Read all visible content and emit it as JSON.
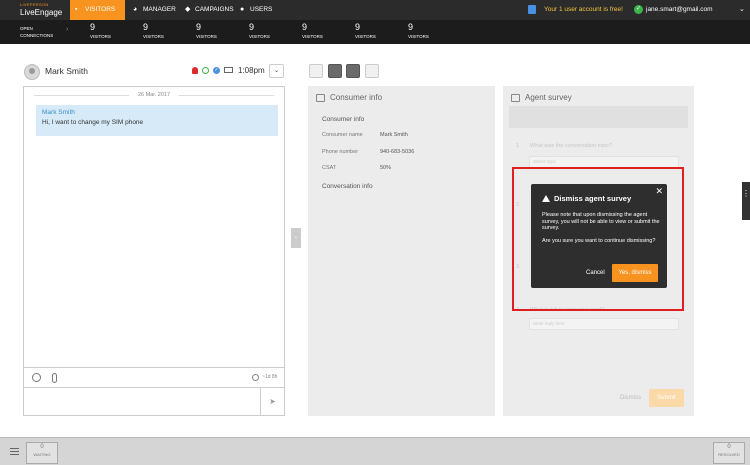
{
  "topnav": {
    "brand": "LIVEPERSON",
    "app_name": "LiveEngage",
    "tabs": [
      {
        "label": "VISITORS",
        "icon": "chat-bubble-icon",
        "active": true
      },
      {
        "label": "MANAGER",
        "icon": "pie-chart-icon",
        "active": false
      },
      {
        "label": "CAMPAIGNS",
        "icon": "tag-icon",
        "active": false
      },
      {
        "label": "USERS",
        "icon": "user-icon",
        "active": false
      }
    ],
    "account_message": "Your 1 user account is free!",
    "user_email": "jane.smart@gmail.com"
  },
  "stats": {
    "label": "OPEN CONNECTIONS",
    "items": [
      {
        "value": "9",
        "label": "VISITORS"
      },
      {
        "value": "9",
        "label": "VISITORS"
      },
      {
        "value": "9",
        "label": "VISITORS"
      },
      {
        "value": "9",
        "label": "VISITORS"
      },
      {
        "value": "9",
        "label": "VISITORS"
      },
      {
        "value": "9",
        "label": "VISITORS"
      },
      {
        "value": "9",
        "label": "VISITORS"
      }
    ]
  },
  "chat": {
    "consumer_name": "Mark Smith",
    "time": "1:08pm",
    "date": "26 Mar. 2017",
    "message": {
      "sender": "Mark Smith",
      "text": "Hi, I want to change my SIM phone"
    },
    "elapsed": "~1d 8h"
  },
  "consumer_info": {
    "title": "Consumer info",
    "section": "Consumer info",
    "fields": [
      {
        "key": "Consumer name",
        "value": "Mark Smith"
      },
      {
        "key": "Phone number",
        "value": "940-683-5036"
      },
      {
        "key": "CSAT",
        "value": "50%"
      }
    ],
    "conversation_title": "Conversation info"
  },
  "survey": {
    "title": "Agent survey",
    "q1_num": "1",
    "q1_text": "What was the conversation topic?",
    "q1_placeholder": "Select topic",
    "q2_num": "2",
    "q3_num": "3",
    "q4_num": "4",
    "q4_text": "What to tell to consumer next?",
    "q4_placeholder": "Write reply here",
    "dismiss": "Dismiss",
    "submit": "Submit"
  },
  "dialog": {
    "title": "Dismiss agent survey",
    "body1": "Please note that upon dismissing the agent survey, you will not be able to view or submit the survey.",
    "body2": "Are you sure you want to continue dismissing?",
    "cancel": "Cancel",
    "confirm": "Yes, dismiss"
  },
  "bottom": {
    "waiting": {
      "value": "0",
      "label": "WAITING"
    },
    "resolved": {
      "value": "0",
      "label": "RESOLVED"
    }
  },
  "colors": {
    "accent": "#f7931e",
    "topbar": "#2b2b2b",
    "alert": "#e02020"
  }
}
